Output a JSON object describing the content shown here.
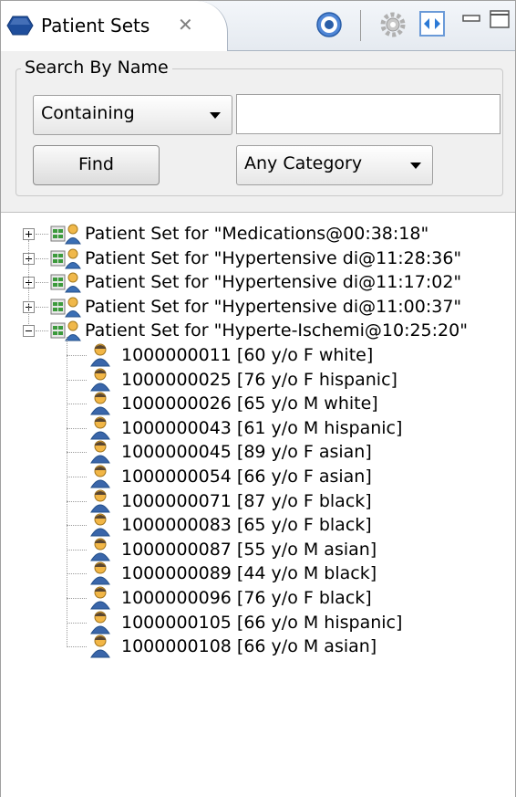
{
  "tab": {
    "title": "Patient Sets"
  },
  "search": {
    "group_title": "Search By Name",
    "match_mode": "Containing",
    "query": "",
    "find_label": "Find",
    "category": "Any Category"
  },
  "tree": {
    "sets": [
      {
        "label": "Patient Set for \"Medications@00:38:18\"",
        "expanded": false
      },
      {
        "label": "Patient Set for \"Hypertensive di@11:28:36\"",
        "expanded": false
      },
      {
        "label": "Patient Set for \"Hypertensive di@11:17:02\"",
        "expanded": false
      },
      {
        "label": "Patient Set for \"Hypertensive di@11:00:37\"",
        "expanded": false
      },
      {
        "label": "Patient Set for \"Hyperte-Ischemi@10:25:20\"",
        "expanded": true
      }
    ],
    "patients": [
      "1000000011 [60 y/o F white]",
      "1000000025 [76 y/o F hispanic]",
      "1000000026 [65 y/o M white]",
      "1000000043 [61 y/o M hispanic]",
      "1000000045 [89 y/o F asian]",
      "1000000054 [66 y/o F asian]",
      "1000000071 [87 y/o F black]",
      "1000000083 [65 y/o F black]",
      "1000000087 [55 y/o M asian]",
      "1000000089 [44 y/o M black]",
      "1000000096 [76 y/o F black]",
      "1000000105 [66 y/o M hispanic]",
      "1000000108 [66 y/o M asian]"
    ]
  },
  "colors": {
    "accent": "#1f4e9c",
    "tab_bg": "#e5eaf0"
  }
}
